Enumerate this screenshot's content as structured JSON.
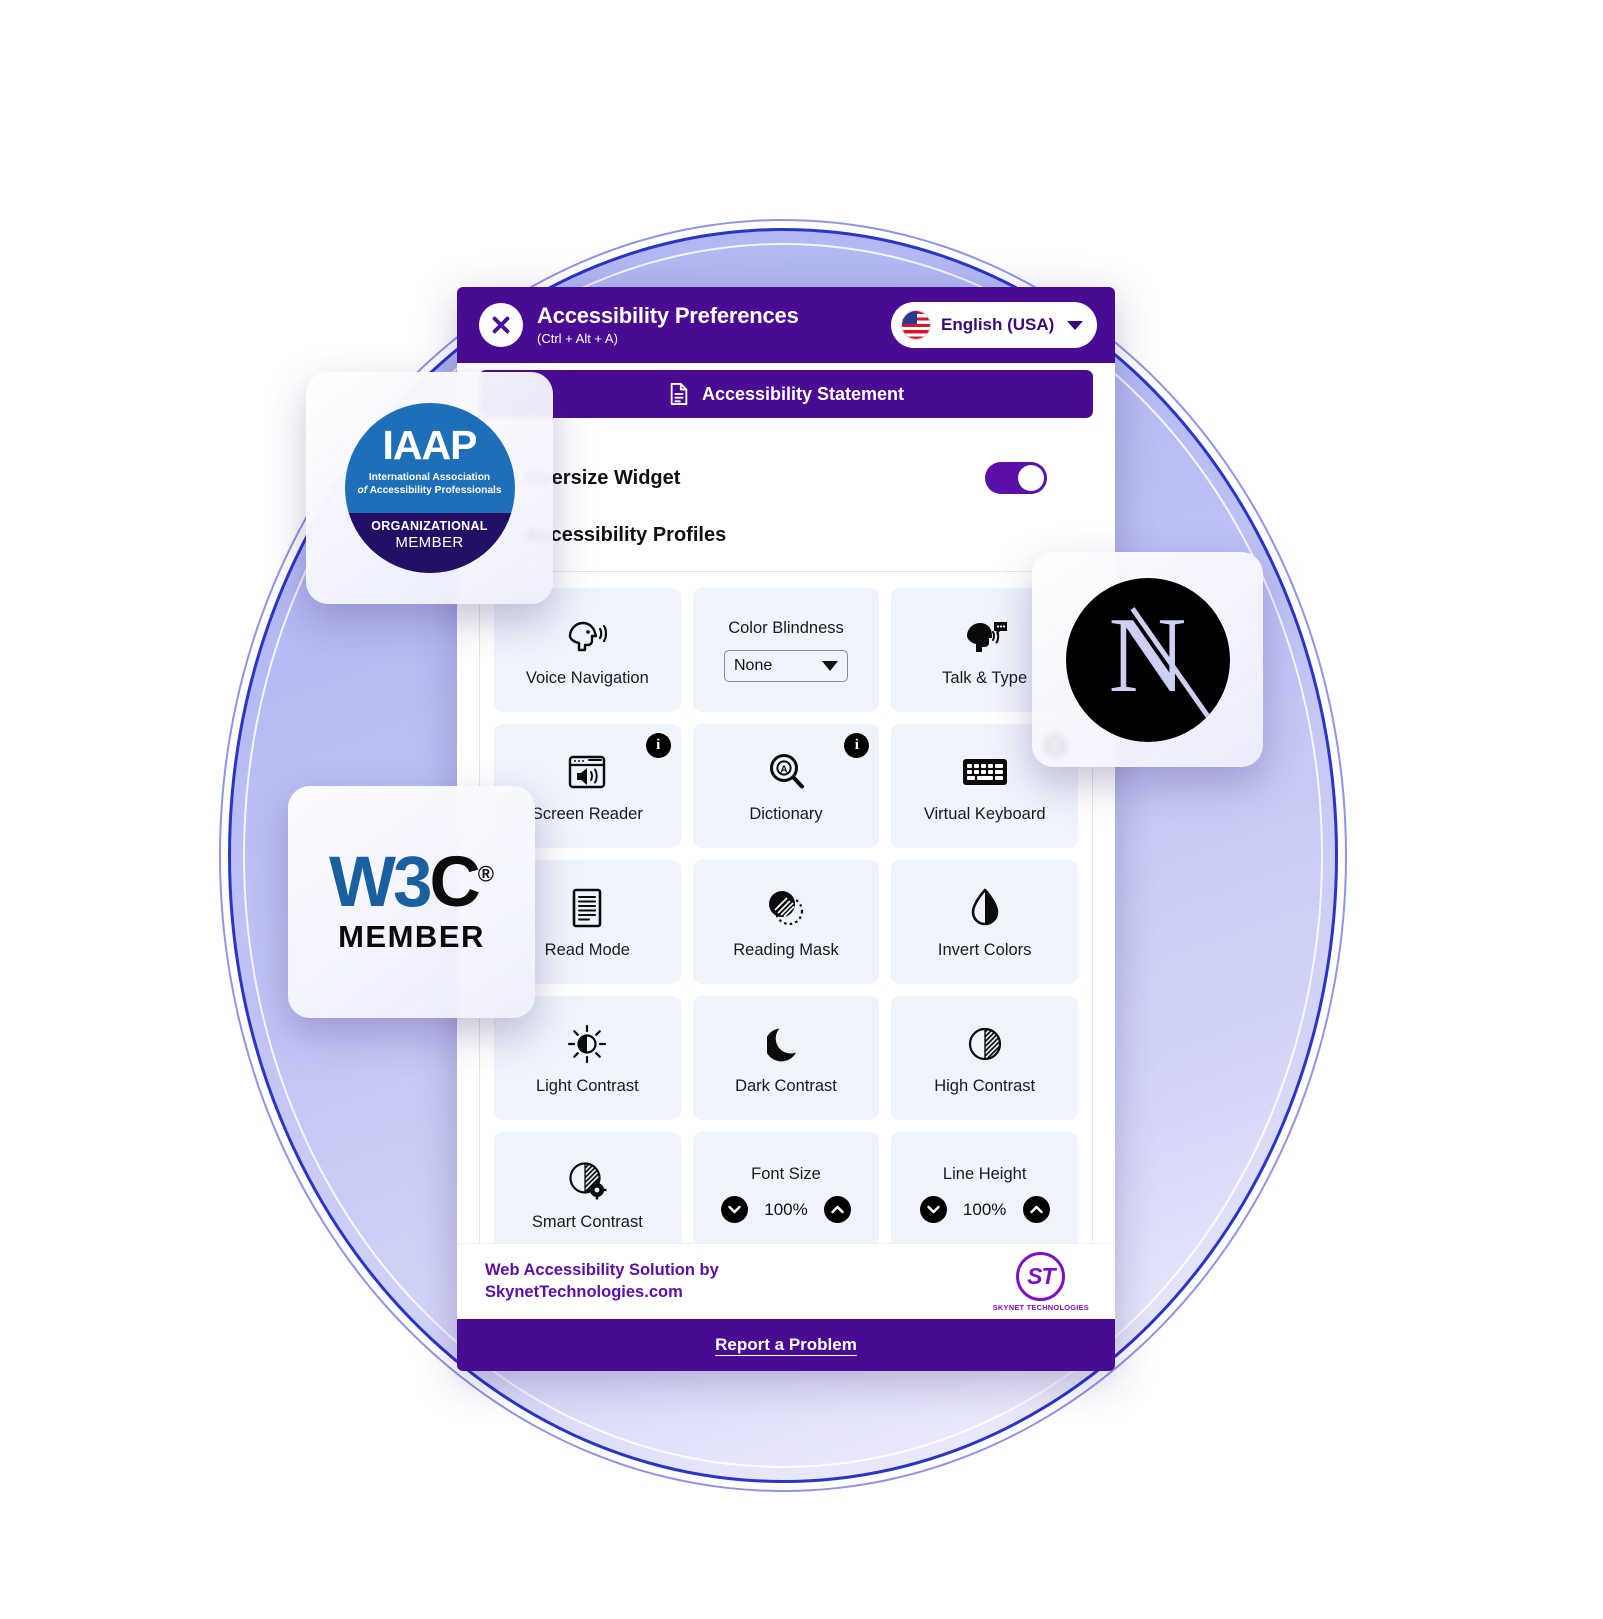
{
  "header": {
    "close_icon": "close-x-icon",
    "title": "Accessibility Preferences",
    "shortcut": "(Ctrl + Alt + A)",
    "language": "English (USA)",
    "language_flag": "usa-flag-icon",
    "chevron_icon": "chevron-down-icon",
    "accent_purple": "#4a0b93"
  },
  "statement": {
    "label": "Accessibility Statement",
    "icon": "document-icon"
  },
  "settings": {
    "oversize_widget_label": "Oversize Widget",
    "oversize_widget_on": true,
    "toggle_color": "#5a0fa8",
    "profiles_label": "Accessibility Profiles"
  },
  "tiles": [
    {
      "type": "icon",
      "label": "Voice Navigation",
      "icon": "voice-navigation-icon",
      "info": false
    },
    {
      "type": "dropdown",
      "label": "Color Blindness",
      "icon": "color-blindness-select",
      "value": "None",
      "info": false
    },
    {
      "type": "icon",
      "label": "Talk & Type",
      "icon": "talk-and-type-icon",
      "info": false
    },
    {
      "type": "icon",
      "label": "Screen Reader",
      "icon": "screen-reader-icon",
      "info": true
    },
    {
      "type": "icon",
      "label": "Dictionary",
      "icon": "dictionary-icon",
      "info": true
    },
    {
      "type": "icon",
      "label": "Virtual Keyboard",
      "icon": "virtual-keyboard-icon",
      "info": true
    },
    {
      "type": "icon",
      "label": "Read Mode",
      "icon": "read-mode-icon",
      "info": false
    },
    {
      "type": "icon",
      "label": "Reading Mask",
      "icon": "reading-mask-icon",
      "info": false
    },
    {
      "type": "icon",
      "label": "Invert Colors",
      "icon": "invert-colors-icon",
      "info": false
    },
    {
      "type": "icon",
      "label": "Light Contrast",
      "icon": "light-contrast-icon",
      "info": false
    },
    {
      "type": "icon",
      "label": "Dark Contrast",
      "icon": "dark-contrast-moon-icon",
      "info": false
    },
    {
      "type": "icon",
      "label": "High Contrast",
      "icon": "high-contrast-icon",
      "info": false
    },
    {
      "type": "icon",
      "label": "Smart Contrast",
      "icon": "smart-contrast-icon",
      "info": false
    },
    {
      "type": "stepper",
      "label": "Font Size",
      "icon": "font-size-stepper",
      "value": "100%"
    },
    {
      "type": "stepper",
      "label": "Line Height",
      "icon": "line-height-stepper",
      "value": "100%"
    }
  ],
  "sponsor": {
    "line1": "Web Accessibility Solution by",
    "line2": "SkynetTechnologies.com",
    "logo_mark": "ST",
    "logo_caption": "SKYNET TECHNOLOGIES",
    "brand_color": "#7b10c7"
  },
  "report": {
    "label": "Report a Problem"
  },
  "badges": {
    "iaap": {
      "logo": "IAAP",
      "line1": "International Association",
      "line2_italic": "of",
      "line2": "Accessibility Professionals",
      "tier": "ORGANIZATIONAL",
      "member": "MEMBER",
      "circle_color": "#1e6fb8",
      "band_color": "#231066"
    },
    "w3c": {
      "w": "W3",
      "c": "C",
      "registered": "®",
      "member": "MEMBER",
      "blue": "#1a5f9e"
    },
    "nextjs": {
      "letter": "N",
      "name": "nextjs-logo-icon"
    }
  }
}
